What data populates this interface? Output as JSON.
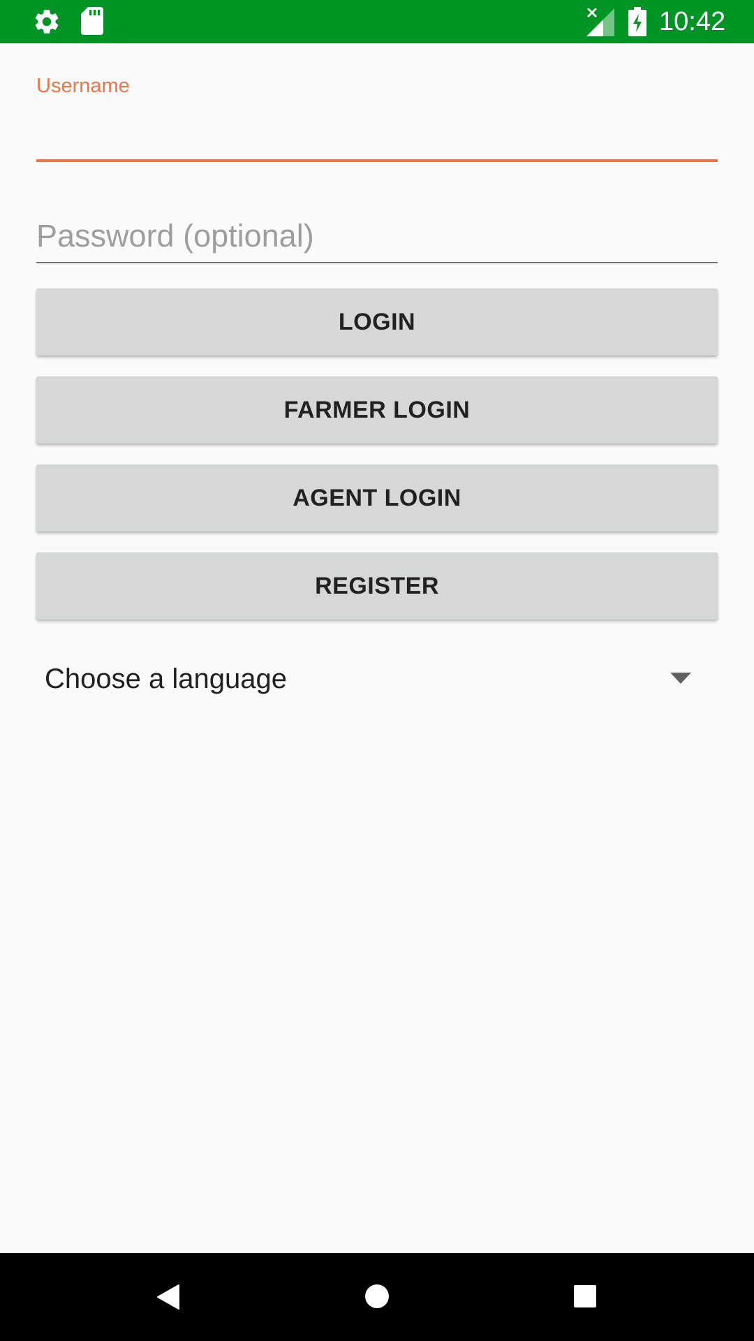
{
  "status_bar": {
    "time": "10:42",
    "background_color": "#009424",
    "left_icons": [
      "gear-icon",
      "sd-card-icon"
    ],
    "right_icons": [
      "signal-no-data-icon",
      "battery-charging-icon"
    ]
  },
  "login_form": {
    "username_label": "Username",
    "username_value": "",
    "password_placeholder": "Password (optional)",
    "password_value": "",
    "accent_color": "#f07446"
  },
  "buttons": {
    "login": "LOGIN",
    "farmer_login": "FARMER LOGIN",
    "agent_login": "AGENT LOGIN",
    "register": "REGISTER"
  },
  "language_spinner": {
    "selected": "Choose a language",
    "icon": "dropdown-arrow-icon"
  },
  "nav_bar": {
    "icons": [
      "back-icon",
      "home-icon",
      "recents-icon"
    ]
  }
}
